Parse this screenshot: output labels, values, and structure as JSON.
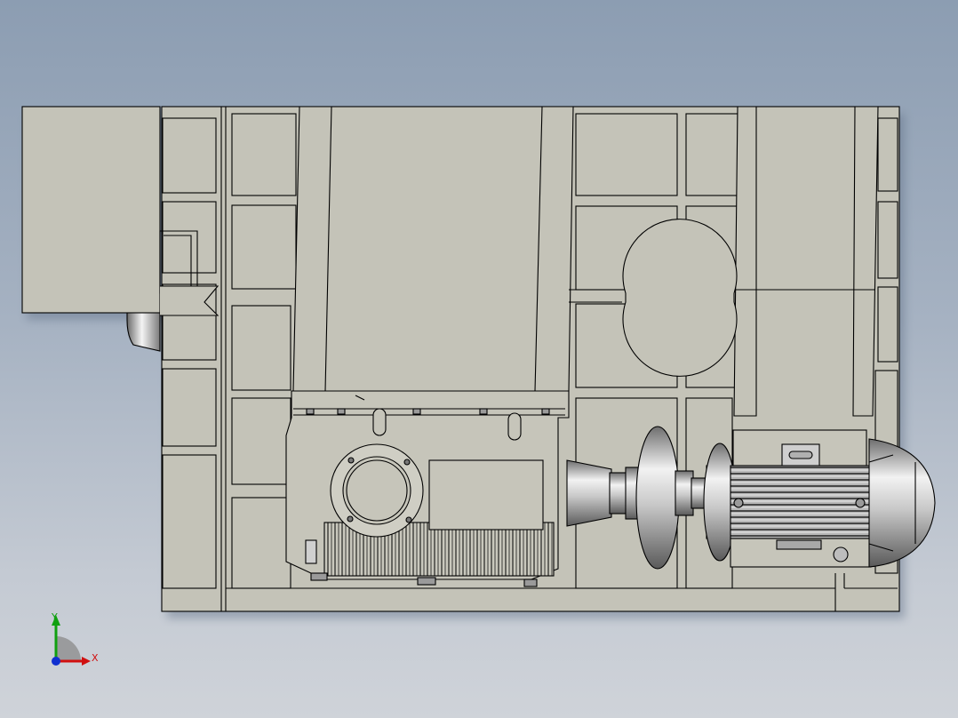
{
  "viewport": {
    "background_top": "#8c9db2",
    "background_bottom": "#cfd3d9",
    "model_face_color": "#c4c3b8",
    "edge_color": "#000000",
    "metal_color": "#dcdcdc",
    "shadow_color": "#7d8ea4"
  },
  "triad": {
    "x_label": "X",
    "y_label": "Y",
    "x_color": "#d01010",
    "y_color": "#10a010",
    "z_color": "#1030d0"
  }
}
